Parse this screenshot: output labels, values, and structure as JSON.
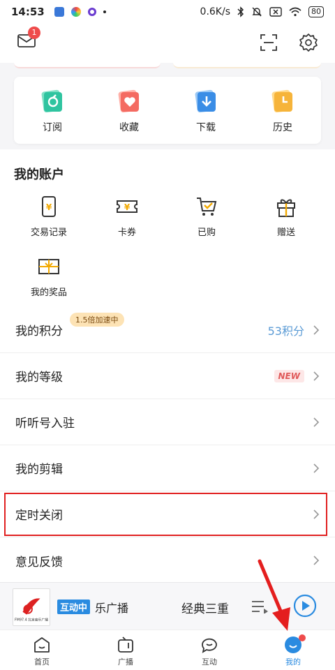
{
  "status_bar": {
    "time": "14:53",
    "net_speed": "0.6K/s",
    "battery": "80"
  },
  "header": {
    "mail_badge": "1"
  },
  "quick_actions": [
    {
      "label": "订阅",
      "icon": "subscribe-icon"
    },
    {
      "label": "收藏",
      "icon": "favorite-icon"
    },
    {
      "label": "下载",
      "icon": "download-icon"
    },
    {
      "label": "历史",
      "icon": "history-icon"
    }
  ],
  "account": {
    "title": "我的账户",
    "items": [
      {
        "label": "交易记录",
        "icon": "transaction-icon"
      },
      {
        "label": "卡券",
        "icon": "coupon-icon"
      },
      {
        "label": "已购",
        "icon": "purchased-icon"
      },
      {
        "label": "赠送",
        "icon": "gift-icon"
      },
      {
        "label": "我的奖品",
        "icon": "prize-icon"
      }
    ]
  },
  "rows": {
    "points": {
      "label": "我的积分",
      "pill": "1.5倍加速中",
      "value": "53积分"
    },
    "level": {
      "label": "我的等级",
      "badge": "NEW"
    },
    "join": {
      "label": "听听号入驻"
    },
    "clips": {
      "label": "我的剪辑"
    },
    "timer": {
      "label": "定时关闭"
    },
    "feedback": {
      "label": "意见反馈"
    }
  },
  "player": {
    "live_tag": "互动中",
    "station": "乐广播",
    "program": "经典三重",
    "cover_text": "FM97.4 北京音乐广播"
  },
  "nav": [
    {
      "label": "首页",
      "icon": "home-icon"
    },
    {
      "label": "广播",
      "icon": "radio-icon"
    },
    {
      "label": "互动",
      "icon": "chat-icon"
    },
    {
      "label": "我的",
      "icon": "profile-icon"
    }
  ],
  "colors": {
    "accent": "#2a8be0",
    "badge": "#ef4b4b",
    "highlight": "#e02020"
  }
}
